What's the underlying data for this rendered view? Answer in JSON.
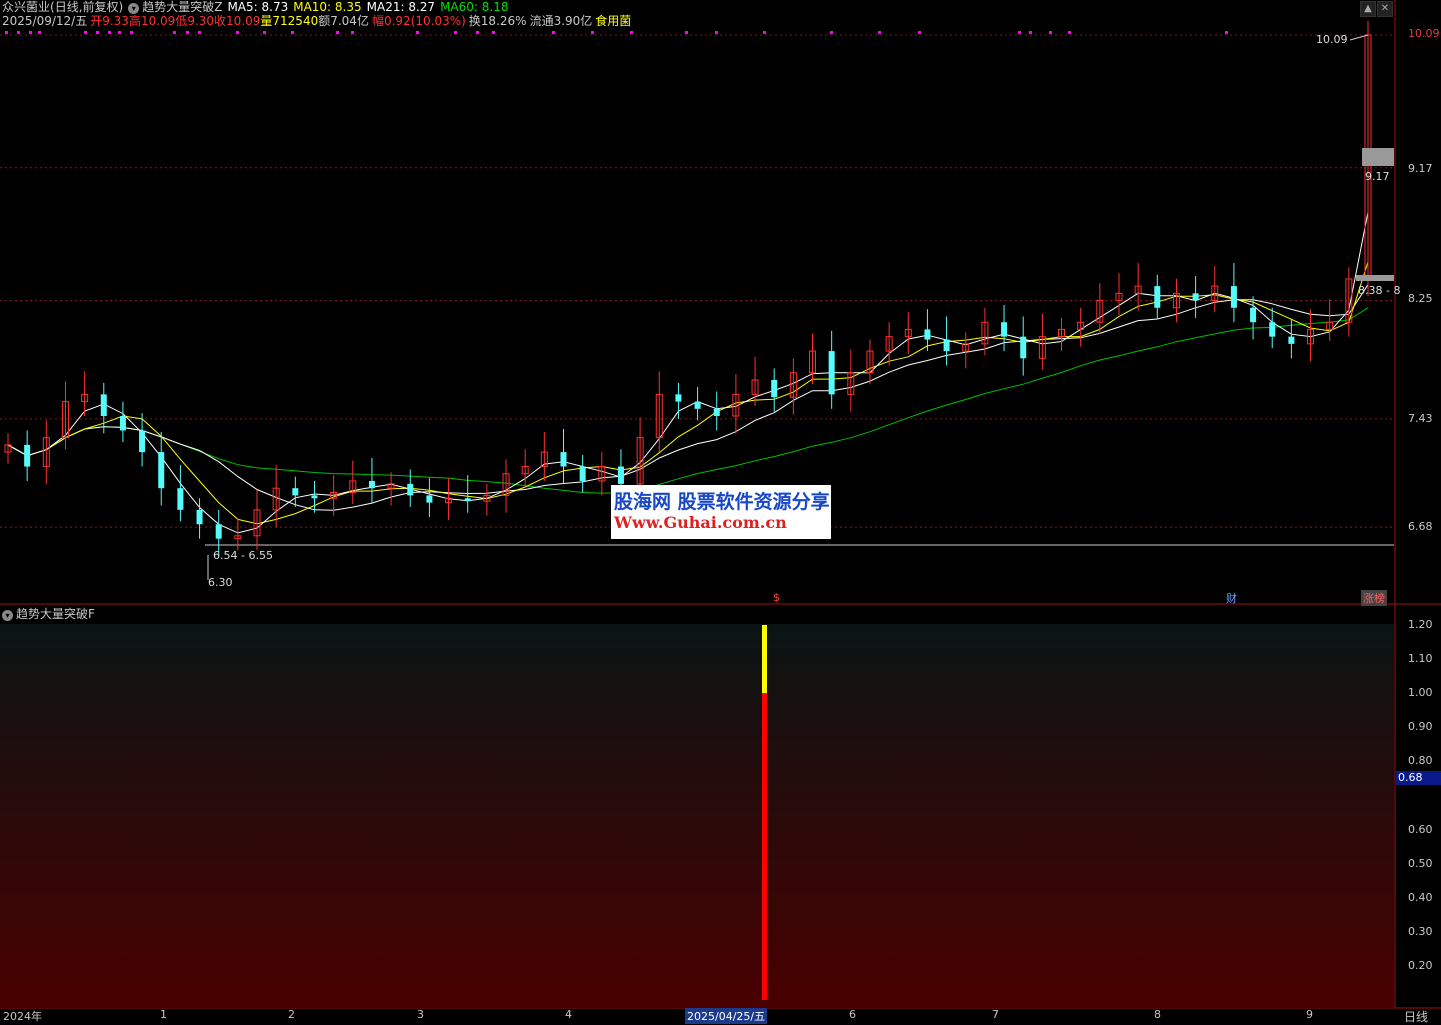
{
  "header": {
    "stock_name": "众兴菌业",
    "period_mode": "(日线,前复权)",
    "indicator_main": "趋势大量突破Z",
    "ma5": "MA5: 8.73",
    "ma10": "MA10: 8.35",
    "ma21": "MA21: 8.27",
    "ma60": "MA60: 8.18",
    "date": "2025/09/12/五",
    "open": "开9.33",
    "high": "高10.09",
    "low": "低9.30",
    "close": "收10.09",
    "volume": "量712540",
    "amount": "额7.04亿",
    "change": "幅0.92(10.03%)",
    "turnover": "换18.26%",
    "float": "流通3.90亿",
    "sector": "食用菌"
  },
  "colors": {
    "up": "#ff3030",
    "down": "#54fcfc",
    "ma5": "#ffffff",
    "ma10": "#ffff00",
    "ma21": "#ffffff",
    "ma60": "#00c000",
    "grid": "#7a1a1a",
    "border": "#a01010",
    "magenta": "#ff00ff"
  },
  "main_axis": {
    "labels": [
      "10.09",
      "9.17",
      "8.25",
      "7.43",
      "6.68"
    ]
  },
  "annotations": {
    "high_price": "10.09",
    "mid_price": "9.17",
    "range_price": "8.38 - 8",
    "low_range": "6.54 - 6.55",
    "low_price": "6.30"
  },
  "markers": {
    "event_s": "$",
    "finance": "财",
    "limit_board": "涨榜"
  },
  "watermark": {
    "line1": "股海网 股票软件资源分享",
    "line2": "Www.Guhai.com.cn"
  },
  "sub": {
    "title": "趋势大量突破F",
    "axis_labels": [
      "1.20",
      "1.10",
      "1.00",
      "0.90",
      "0.80",
      "0.60",
      "0.50",
      "0.40",
      "0.30",
      "0.20"
    ],
    "current_value": "0.68",
    "signal_value": 1.2,
    "signal_break": 1.0
  },
  "x_axis": {
    "ticks": [
      "2024年",
      "1",
      "2",
      "3",
      "4",
      "2025/04/25/五",
      "6",
      "7",
      "8",
      "9"
    ],
    "period": "日线"
  },
  "chart_data": {
    "type": "bar",
    "title": "",
    "ylim": [
      6.3,
      10.09
    ],
    "close_series": [
      7.25,
      7.1,
      7.3,
      7.55,
      7.6,
      7.45,
      7.35,
      7.2,
      6.95,
      6.8,
      6.7,
      6.6,
      6.62,
      6.8,
      6.95,
      6.9,
      6.88,
      6.92,
      7.0,
      6.95,
      6.98,
      6.9,
      6.85,
      6.88,
      6.86,
      6.9,
      7.05,
      7.1,
      7.2,
      7.1,
      7.0,
      7.1,
      6.98,
      7.3,
      7.6,
      7.55,
      7.5,
      7.45,
      7.6,
      7.7,
      7.58,
      7.75,
      7.9,
      7.6,
      7.75,
      7.9,
      8.0,
      8.05,
      7.98,
      7.9,
      7.95,
      8.1,
      8.0,
      7.85,
      8.0,
      8.05,
      8.1,
      8.25,
      8.3,
      8.35,
      8.2,
      8.3,
      8.25,
      8.35,
      8.2,
      8.1,
      8.0,
      7.95,
      8.05,
      8.1,
      8.4,
      10.09
    ]
  }
}
